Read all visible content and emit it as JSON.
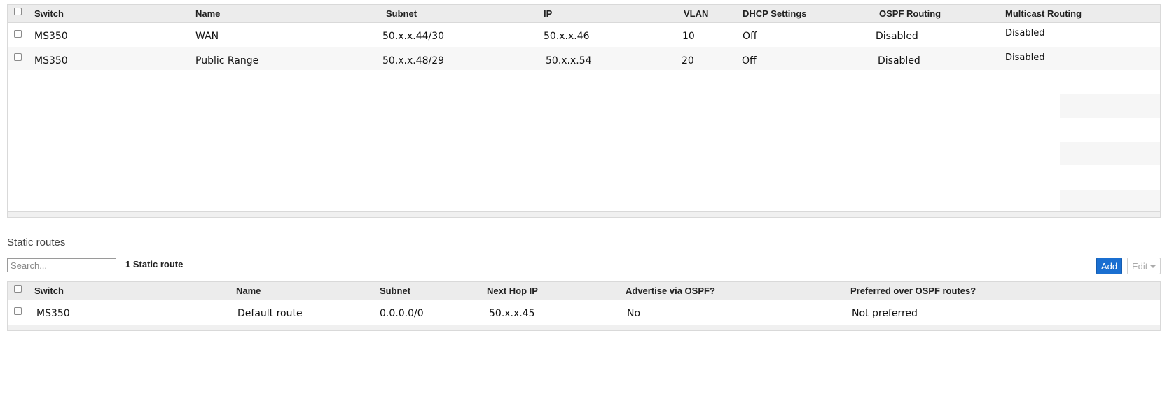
{
  "interfaces": {
    "columns": [
      "Switch",
      "Name",
      "Subnet",
      "IP",
      "VLAN",
      "DHCP Settings",
      "OSPF Routing",
      "Multicast Routing"
    ],
    "rows": [
      {
        "switch": "MS350",
        "name": "WAN",
        "subnet": "50.x.x.44/30",
        "ip": "50.x.x.46",
        "vlan": "10",
        "dhcp": "Off",
        "ospf": "Disabled",
        "multicast": "Disabled"
      },
      {
        "switch": "MS350",
        "name": "Public Range",
        "subnet": "50.x.x.48/29",
        "ip": "50.x.x.54",
        "vlan": "20",
        "dhcp": "Off",
        "ospf": "Disabled",
        "multicast": "Disabled"
      }
    ]
  },
  "static_routes": {
    "title": "Static routes",
    "search_placeholder": "Search...",
    "count_label": "1 Static route",
    "add_label": "Add",
    "edit_label": "Edit",
    "columns": [
      "Switch",
      "Name",
      "Subnet",
      "Next Hop IP",
      "Advertise via OSPF?",
      "Preferred over OSPF routes?"
    ],
    "rows": [
      {
        "switch": "MS350",
        "name": "Default route",
        "subnet": "0.0.0.0/0",
        "next_hop": "50.x.x.45",
        "advertise": "No",
        "preferred": "Not preferred"
      }
    ]
  },
  "colors": {
    "primary_button": "#1a6fd1",
    "header_bg": "#ececec",
    "border": "#d9d9d9"
  }
}
